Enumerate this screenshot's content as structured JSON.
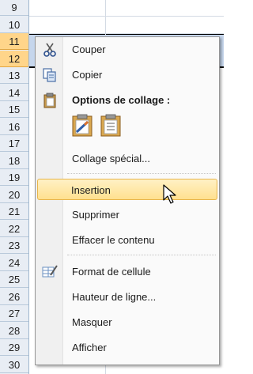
{
  "rows": [
    "9",
    "10",
    "11",
    "12",
    "13",
    "14",
    "15",
    "16",
    "17",
    "18",
    "19",
    "20",
    "21",
    "22",
    "23",
    "24",
    "25",
    "26",
    "27",
    "28",
    "29",
    "30"
  ],
  "menu": {
    "cut": "Couper",
    "copy": "Copier",
    "paste_options": "Options de collage :",
    "paste_special": "Collage spécial...",
    "insert": "Insertion",
    "delete": "Supprimer",
    "clear": "Effacer le contenu",
    "format_cells": "Format de cellule",
    "row_height": "Hauteur de ligne...",
    "hide": "Masquer",
    "unhide": "Afficher"
  },
  "icons": {
    "cut": "scissors-icon",
    "copy": "copy-icon",
    "paste": "clipboard-icon",
    "format": "format-cells-icon",
    "pointer": "mouse-pointer-icon"
  },
  "colors": {
    "highlight": "#ffe08f",
    "selected_row_header": "#ffd58a"
  }
}
